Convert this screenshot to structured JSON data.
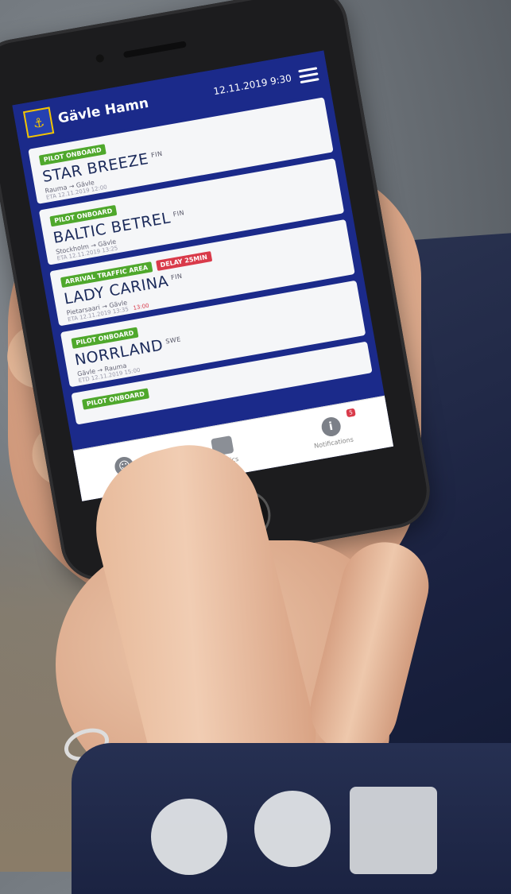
{
  "app": {
    "name": "Gävle Hamn",
    "datetime": "12.11.2019 9:30"
  },
  "vessels": [
    {
      "badges": [
        "PILOT ONBOARD"
      ],
      "name": "STAR BREEZE",
      "flag": "FIN",
      "from": "Rauma",
      "to": "Gävle",
      "eta": "ETA 12.11.2019 12:00",
      "late": ""
    },
    {
      "badges": [
        "PILOT ONBOARD"
      ],
      "name": "BALTIC BETREL",
      "flag": "FIN",
      "from": "Stockholm",
      "to": "Gävle",
      "eta": "ETA 12.11.2019 13:25",
      "late": ""
    },
    {
      "badges": [
        "ARRIVAL TRAFFIC AREA",
        "DELAY 25MIN"
      ],
      "name": "LADY CARINA",
      "flag": "FIN",
      "from": "Pietarsaari",
      "to": "Gävle",
      "eta": "ETA 12.11.2019 13:35",
      "late": "13:00"
    },
    {
      "badges": [
        "PILOT ONBOARD"
      ],
      "name": "NORRLAND",
      "flag": "SWE",
      "from": "Gävle",
      "to": "Rauma",
      "eta": "ETD 12.11.2019 15:00",
      "late": ""
    },
    {
      "badges": [
        "PILOT ONBOARD"
      ],
      "name": "",
      "flag": "",
      "from": "",
      "to": "",
      "eta": "",
      "late": ""
    }
  ],
  "tabs": [
    {
      "label": "",
      "icon": "person-icon"
    },
    {
      "label": "Logistics",
      "icon": "truck-icon"
    },
    {
      "label": "Notifications",
      "icon": "info-icon",
      "count": "5"
    }
  ],
  "colors": {
    "brand": "#1b2a8a",
    "badge_green": "#4fa82c",
    "badge_red": "#d93a4a",
    "logo_yellow": "#f3c400"
  }
}
